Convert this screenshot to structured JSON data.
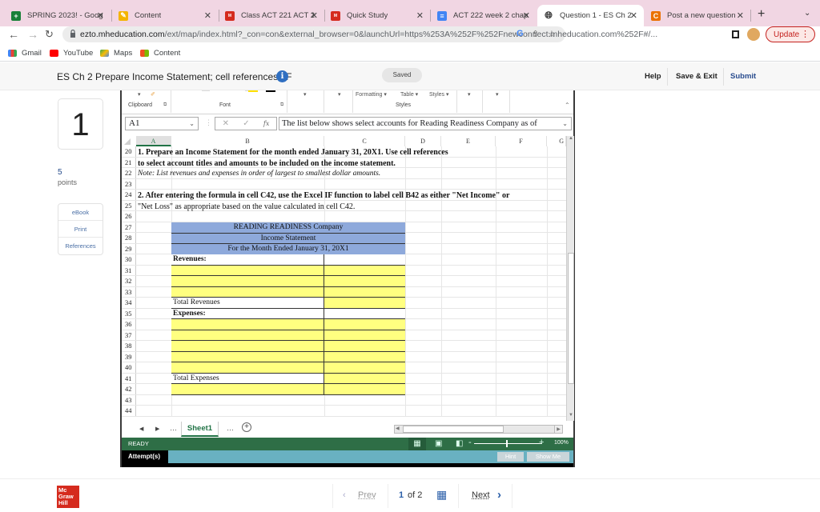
{
  "browser": {
    "tabs": [
      {
        "label": "SPRING 2023! - Goog",
        "icon": "google-sheets-icon",
        "color": "#188038"
      },
      {
        "label": "Content",
        "icon": "pencil-icon",
        "color": "#f4b400"
      },
      {
        "label": "Class ACT 221 ACT 2",
        "icon": "mcgraw-hill-icon",
        "color": "#d52b1e"
      },
      {
        "label": "Quick Study",
        "icon": "mcgraw-hill-icon",
        "color": "#d52b1e"
      },
      {
        "label": "ACT 222 week 2 chap",
        "icon": "google-docs-icon",
        "color": "#4285f4"
      },
      {
        "label": "Question 1 - ES Ch 2",
        "icon": "globe-icon",
        "color": "#333333",
        "active": true
      },
      {
        "label": "Post a new question",
        "icon": "chegg-icon",
        "color": "#eb7100"
      }
    ],
    "url_domain": "ezto.mheducation.com",
    "url_path": "/ext/map/index.html?_con=con&external_browser=0&launchUrl=https%253A%252F%252Fnewconnect.mheducation.com%252F#/...",
    "update_label": "Update",
    "bookmarks": [
      {
        "label": "Gmail",
        "icon": "gmail-icon"
      },
      {
        "label": "YouTube",
        "icon": "youtube-icon"
      },
      {
        "label": "Maps",
        "icon": "maps-icon"
      },
      {
        "label": "Content",
        "icon": "content-icon"
      }
    ]
  },
  "header": {
    "title": "ES Ch 2 Prepare Income Statement; cell references, IF",
    "saved": "Saved",
    "help": "Help",
    "save_exit": "Save & Exit",
    "submit": "Submit"
  },
  "question": {
    "number": "1",
    "points": "5",
    "points_label": "points",
    "tools": [
      "eBook",
      "Print",
      "References"
    ]
  },
  "excel": {
    "ribbon": {
      "groups": [
        "Clipboard",
        "Font",
        "Styles"
      ],
      "style_buttons": [
        "Formatting",
        "Table",
        "Styles"
      ]
    },
    "name_box": "A1",
    "formula_bar": "The list below shows select accounts for Reading Readiness Company as of",
    "columns": [
      "A",
      "B",
      "C",
      "D",
      "E",
      "F",
      "G"
    ],
    "rows": [
      "20",
      "21",
      "22",
      "23",
      "24",
      "25",
      "26",
      "27",
      "28",
      "29",
      "30",
      "31",
      "32",
      "33",
      "34",
      "35",
      "36",
      "37",
      "38",
      "39",
      "40",
      "41",
      "42",
      "43",
      "44"
    ],
    "instructions": {
      "r20": "1. Prepare an Income Statement for the month ended January 31, 20X1.  Use cell references",
      "r21": "to select account titles and amounts to be included on the income statement.",
      "r22": "Note:  List revenues and expenses in order of largest to smallest dollar amounts.",
      "r24": "2. After entering the formula in cell C42, use the Excel IF function to label cell B42 as either  \"Net Income\" or",
      "r25": "\"Net Loss\" as appropriate based on the value calculated in cell C42."
    },
    "statement": {
      "company": "READING READINESS Company",
      "title": "Income Statement",
      "period": "For the Month Ended January 31, 20X1",
      "revenues_label": "Revenues:",
      "total_revenues": "Total Revenues",
      "expenses_label": "Expenses:",
      "total_expenses": "Total Expenses"
    },
    "sheet_tab": "Sheet1",
    "status": "READY",
    "zoom": "100%",
    "attempts_label": "Attempt(s)",
    "hint": "Hint",
    "show_me": "Show Me"
  },
  "footer": {
    "logo": [
      "Mc",
      "Graw",
      "Hill"
    ],
    "prev": "Prev",
    "current_page": "1",
    "of": "of 2",
    "next": "Next"
  }
}
